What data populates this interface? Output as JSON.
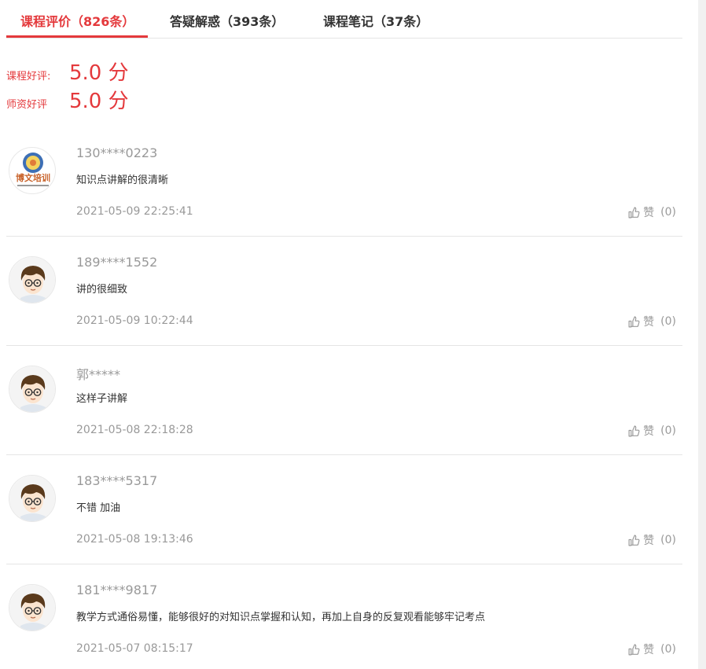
{
  "tabs": [
    {
      "label": "课程评价（826条）"
    },
    {
      "label": "答疑解惑（393条）"
    },
    {
      "label": "课程笔记（37条）"
    }
  ],
  "ratings": [
    {
      "label": "课程好评:",
      "score": "5.0 分"
    },
    {
      "label": "师资好评",
      "score": "5.0 分"
    }
  ],
  "logo_text": "博文培训",
  "like_label": "赞",
  "reviews": [
    {
      "user": "130****0223",
      "content": "知识点讲解的很清晰",
      "time": "2021-05-09 22:25:41",
      "likes": "(0)",
      "avatar": "logo"
    },
    {
      "user": "189****1552",
      "content": "讲的很细致",
      "time": "2021-05-09 10:22:44",
      "likes": "(0)",
      "avatar": "cartoon"
    },
    {
      "user": "郭*****",
      "content": "这样子讲解",
      "time": "2021-05-08 22:18:28",
      "likes": "(0)",
      "avatar": "cartoon"
    },
    {
      "user": "183****5317",
      "content": "不错 加油",
      "time": "2021-05-08 19:13:46",
      "likes": "(0)",
      "avatar": "cartoon"
    },
    {
      "user": "181****9817",
      "content": "教学方式通俗易懂，能够很好的对知识点掌握和认知，再加上自身的反复观看能够牢记考点",
      "time": "2021-05-07 08:15:17",
      "likes": "(0)",
      "avatar": "cartoon"
    }
  ],
  "colors": {
    "accent": "#e4393c",
    "muted": "#999999",
    "border": "#e5e5e5"
  }
}
